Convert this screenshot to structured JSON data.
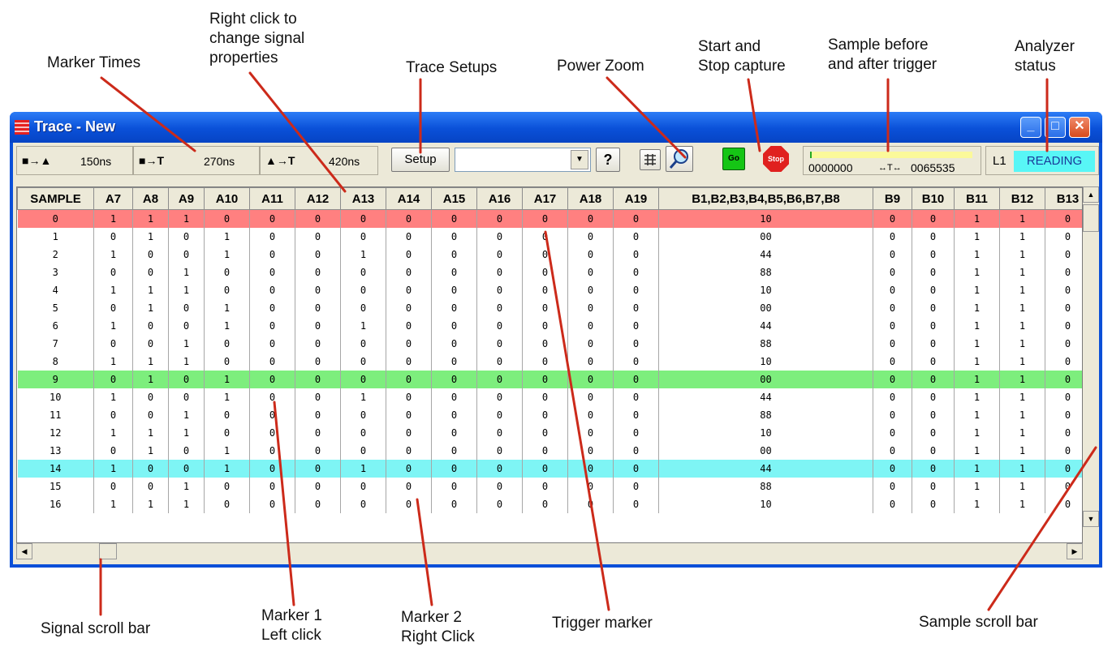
{
  "callouts": {
    "marker_times": "Marker Times",
    "signal_props": "Right click to\nchange signal\nproperties",
    "trace_setups": "Trace Setups",
    "power_zoom": "Power Zoom",
    "start_stop": "Start and\nStop capture",
    "sample_before_after": "Sample before\nand after trigger",
    "analyzer_status": "Analyzer\nstatus",
    "signal_scroll": "Signal scroll bar",
    "marker1": "Marker 1\nLeft click",
    "marker2": "Marker 2\nRight Click",
    "trigger_marker": "Trigger marker",
    "sample_scroll": "Sample scroll bar"
  },
  "window": {
    "title": "Trace - New",
    "min_glyph": "_",
    "max_glyph": "□",
    "close_glyph": "✕"
  },
  "toolbar": {
    "marker_times": [
      {
        "symbol": "■→▲",
        "value": "150ns"
      },
      {
        "symbol": "■→T",
        "value": "270ns"
      },
      {
        "symbol": "▲→T",
        "value": "420ns"
      }
    ],
    "setup_label": "Setup",
    "combo_value": "",
    "help_glyph": "?",
    "go_label": "Go",
    "stop_label": "Stop",
    "pre_trigger": "0000000",
    "arrows": "↔T↔",
    "post_trigger": "0065535",
    "status_level": "L1",
    "status": "READING",
    "progress": 0.01
  },
  "grid": {
    "headers": [
      "SAMPLE",
      "A7",
      "A8",
      "A9",
      "A10",
      "A11",
      "A12",
      "A13",
      "A14",
      "A15",
      "A16",
      "A17",
      "A18",
      "A19",
      "B1,B2,B3,B4,B5,B6,B7,B8",
      "B9",
      "B10",
      "B11",
      "B12",
      "B13"
    ],
    "rows": [
      [
        "0",
        "1",
        "1",
        "1",
        "0",
        "0",
        "0",
        "0",
        "0",
        "0",
        "0",
        "0",
        "0",
        "0",
        "10",
        "0",
        "0",
        "1",
        "1",
        "0"
      ],
      [
        "1",
        "0",
        "1",
        "0",
        "1",
        "0",
        "0",
        "0",
        "0",
        "0",
        "0",
        "0",
        "0",
        "0",
        "00",
        "0",
        "0",
        "1",
        "1",
        "0"
      ],
      [
        "2",
        "1",
        "0",
        "0",
        "1",
        "0",
        "0",
        "1",
        "0",
        "0",
        "0",
        "0",
        "0",
        "0",
        "44",
        "0",
        "0",
        "1",
        "1",
        "0"
      ],
      [
        "3",
        "0",
        "0",
        "1",
        "0",
        "0",
        "0",
        "0",
        "0",
        "0",
        "0",
        "0",
        "0",
        "0",
        "88",
        "0",
        "0",
        "1",
        "1",
        "0"
      ],
      [
        "4",
        "1",
        "1",
        "1",
        "0",
        "0",
        "0",
        "0",
        "0",
        "0",
        "0",
        "0",
        "0",
        "0",
        "10",
        "0",
        "0",
        "1",
        "1",
        "0"
      ],
      [
        "5",
        "0",
        "1",
        "0",
        "1",
        "0",
        "0",
        "0",
        "0",
        "0",
        "0",
        "0",
        "0",
        "0",
        "00",
        "0",
        "0",
        "1",
        "1",
        "0"
      ],
      [
        "6",
        "1",
        "0",
        "0",
        "1",
        "0",
        "0",
        "1",
        "0",
        "0",
        "0",
        "0",
        "0",
        "0",
        "44",
        "0",
        "0",
        "1",
        "1",
        "0"
      ],
      [
        "7",
        "0",
        "0",
        "1",
        "0",
        "0",
        "0",
        "0",
        "0",
        "0",
        "0",
        "0",
        "0",
        "0",
        "88",
        "0",
        "0",
        "1",
        "1",
        "0"
      ],
      [
        "8",
        "1",
        "1",
        "1",
        "0",
        "0",
        "0",
        "0",
        "0",
        "0",
        "0",
        "0",
        "0",
        "0",
        "10",
        "0",
        "0",
        "1",
        "1",
        "0"
      ],
      [
        "9",
        "0",
        "1",
        "0",
        "1",
        "0",
        "0",
        "0",
        "0",
        "0",
        "0",
        "0",
        "0",
        "0",
        "00",
        "0",
        "0",
        "1",
        "1",
        "0"
      ],
      [
        "10",
        "1",
        "0",
        "0",
        "1",
        "0",
        "0",
        "1",
        "0",
        "0",
        "0",
        "0",
        "0",
        "0",
        "44",
        "0",
        "0",
        "1",
        "1",
        "0"
      ],
      [
        "11",
        "0",
        "0",
        "1",
        "0",
        "0",
        "0",
        "0",
        "0",
        "0",
        "0",
        "0",
        "0",
        "0",
        "88",
        "0",
        "0",
        "1",
        "1",
        "0"
      ],
      [
        "12",
        "1",
        "1",
        "1",
        "0",
        "0",
        "0",
        "0",
        "0",
        "0",
        "0",
        "0",
        "0",
        "0",
        "10",
        "0",
        "0",
        "1",
        "1",
        "0"
      ],
      [
        "13",
        "0",
        "1",
        "0",
        "1",
        "0",
        "0",
        "0",
        "0",
        "0",
        "0",
        "0",
        "0",
        "0",
        "00",
        "0",
        "0",
        "1",
        "1",
        "0"
      ],
      [
        "14",
        "1",
        "0",
        "0",
        "1",
        "0",
        "0",
        "1",
        "0",
        "0",
        "0",
        "0",
        "0",
        "0",
        "44",
        "0",
        "0",
        "1",
        "1",
        "0"
      ],
      [
        "15",
        "0",
        "0",
        "1",
        "0",
        "0",
        "0",
        "0",
        "0",
        "0",
        "0",
        "0",
        "0",
        "0",
        "88",
        "0",
        "0",
        "1",
        "1",
        "0"
      ],
      [
        "16",
        "1",
        "1",
        "1",
        "0",
        "0",
        "0",
        "0",
        "0",
        "0",
        "0",
        "0",
        "0",
        "0",
        "10",
        "0",
        "0",
        "1",
        "1",
        "0"
      ]
    ],
    "highlights": {
      "trigger_row": 0,
      "marker1_row": 9,
      "marker2_row": 14
    },
    "colors": {
      "trigger": "#ff8080",
      "marker1": "#7dee7d",
      "marker2": "#7ef5f5"
    }
  },
  "scroll": {
    "up": "▲",
    "down": "▼",
    "left": "◀",
    "right": "▶"
  }
}
